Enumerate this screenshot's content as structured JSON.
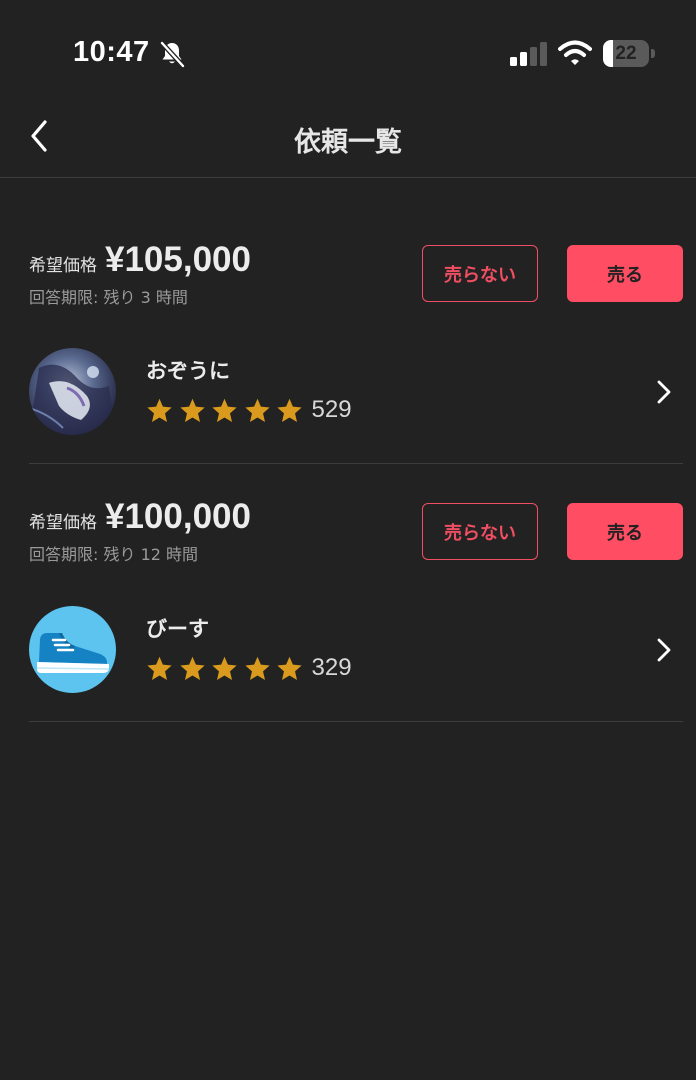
{
  "status_bar": {
    "time": "10:47",
    "battery": "22",
    "battery_level": 0.22
  },
  "header": {
    "title": "依頼一覧"
  },
  "requests": [
    {
      "price_label": "希望価格",
      "price": "¥105,000",
      "deadline": "回答期限: 残り 3 時間",
      "decline_label": "売らない",
      "sell_label": "売る",
      "user": {
        "name": "おぞうに",
        "rating": 5,
        "review_count": "529"
      }
    },
    {
      "price_label": "希望価格",
      "price": "¥100,000",
      "deadline": "回答期限: 残り 12 時間",
      "decline_label": "売らない",
      "sell_label": "売る",
      "user": {
        "name": "びーす",
        "rating": 5,
        "review_count": "329"
      }
    }
  ],
  "colors": {
    "background": "#222222",
    "accent": "#ff4d63",
    "star": "#d99a1e",
    "divider": "#3c3c3c"
  }
}
